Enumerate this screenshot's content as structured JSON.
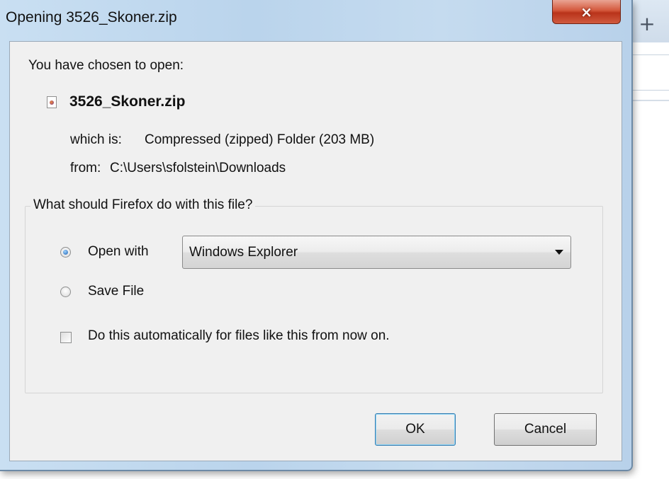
{
  "background": {
    "new_tab_label": "+"
  },
  "dialog": {
    "title": "Opening 3526_Skoner.zip",
    "close_icon": "×",
    "chosen_label": "You have chosen to open:",
    "file_icon": "zip-file-icon",
    "filename": "3526_Skoner.zip",
    "which_is_label": "which is:",
    "which_is_value": "Compressed (zipped) Folder (203 MB)",
    "from_label": "from:",
    "from_value": "C:\\Users\\sfolstein\\Downloads",
    "question": "What should Firefox do with this file?",
    "options": {
      "open_with_label": "Open with",
      "open_with_selected": true,
      "open_with_app": "Windows Explorer",
      "save_file_label": "Save File",
      "save_file_selected": false,
      "auto_label": "Do this automatically for files like this from now on.",
      "auto_checked": false
    },
    "buttons": {
      "ok": "OK",
      "cancel": "Cancel"
    }
  }
}
